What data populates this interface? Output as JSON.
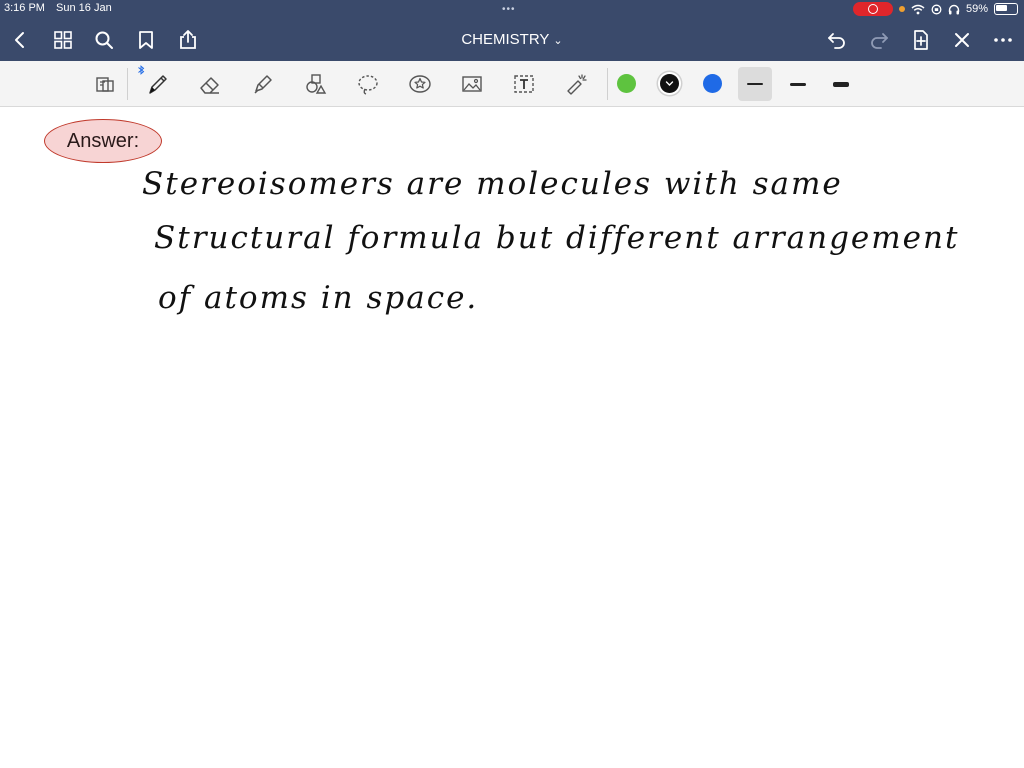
{
  "status_bar": {
    "time": "3:16 PM",
    "date": "Sun 16 Jan",
    "battery": "59%",
    "icons": [
      "record-icon",
      "wifi-icon",
      "headphones-icon",
      "battery-icon"
    ]
  },
  "nav": {
    "title": "CHEMISTRY",
    "left_icons": [
      "back-icon",
      "grid-icon",
      "search-icon",
      "bookmark-icon",
      "share-icon"
    ],
    "right_icons": [
      "undo-icon",
      "redo-icon",
      "add-page-icon",
      "close-icon",
      "more-icon"
    ]
  },
  "toolbar": {
    "tools": [
      "read-mode-icon",
      "pen-icon",
      "eraser-icon",
      "highlighter-icon",
      "shapes-icon",
      "lasso-icon",
      "sticker-icon",
      "image-icon",
      "text-icon",
      "laser-pointer-icon"
    ],
    "colors": [
      "#5ec33f",
      "#111111",
      "#1f6ae6"
    ],
    "selected_color": "#111111",
    "stroke_widths": [
      "thin",
      "medium",
      "thick"
    ],
    "selected_stroke": "thin"
  },
  "note": {
    "label": "Answer:",
    "lines": [
      "Stereoisomers   are   molecules   with   same",
      "Structural   formula   but   different   arrangement",
      "of   atoms   in   space."
    ]
  }
}
